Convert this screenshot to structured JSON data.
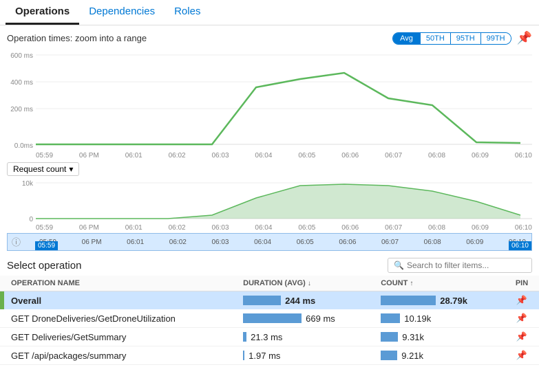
{
  "tabs": [
    {
      "label": "Operations",
      "active": true
    },
    {
      "label": "Dependencies",
      "active": false
    },
    {
      "label": "Roles",
      "active": false
    }
  ],
  "chart": {
    "title": "Operation times: zoom into a range",
    "percentiles": [
      "Avg",
      "50TH",
      "95TH",
      "99TH"
    ],
    "active_percentile": "Avg",
    "y_labels": [
      "600 ms",
      "400 ms",
      "200 ms",
      "0.0ms"
    ],
    "x_labels": [
      "05:59",
      "06 PM",
      "06:01",
      "06:02",
      "06:03",
      "06:04",
      "06:05",
      "06:06",
      "06:07",
      "06:08",
      "06:09",
      "06:10"
    ]
  },
  "request_count": {
    "label": "Request count",
    "y_labels": [
      "10k",
      "0"
    ]
  },
  "range": {
    "start": "05:59",
    "end": "06:10",
    "x_labels": [
      "05:59",
      "06 PM",
      "06:01",
      "06:02",
      "06:03",
      "06:04",
      "06:05",
      "06:06",
      "06:07",
      "06:08",
      "06:09",
      "06:10",
      "06:10"
    ]
  },
  "select_operation": {
    "title": "Select operation",
    "search_placeholder": "Search to filter items..."
  },
  "table": {
    "columns": [
      {
        "label": "OPERATION NAME",
        "key": "name"
      },
      {
        "label": "DURATION (AVG)",
        "key": "duration",
        "sortable": true
      },
      {
        "label": "COUNT",
        "key": "count",
        "sortable": true
      },
      {
        "label": "PIN",
        "key": "pin"
      }
    ],
    "rows": [
      {
        "name": "Overall",
        "duration": "244 ms",
        "duration_pct": 55,
        "count": "28.79k",
        "count_pct": 100,
        "selected": true,
        "accent": true
      },
      {
        "name": "GET DroneDeliveries/GetDroneUtilization",
        "duration": "669 ms",
        "duration_pct": 100,
        "count": "10.19k",
        "count_pct": 35,
        "selected": false,
        "accent": false
      },
      {
        "name": "GET Deliveries/GetSummary",
        "duration": "21.3 ms",
        "duration_pct": 5,
        "count": "9.31k",
        "count_pct": 32,
        "selected": false,
        "accent": false
      },
      {
        "name": "GET /api/packages/summary",
        "duration": "1.97 ms",
        "duration_pct": 1,
        "count": "9.21k",
        "count_pct": 32,
        "selected": false,
        "accent": false
      }
    ]
  }
}
